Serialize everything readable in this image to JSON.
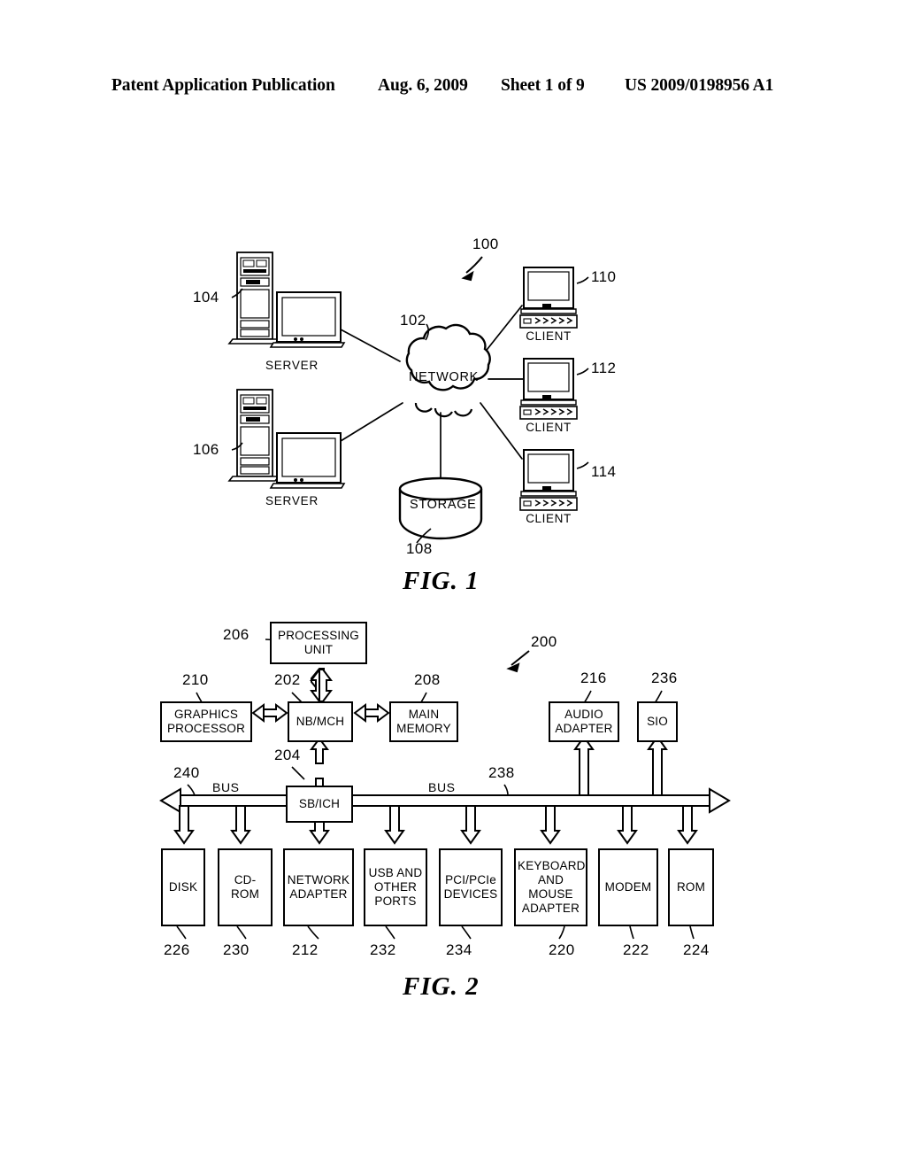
{
  "header": {
    "publication": "Patent Application Publication",
    "date": "Aug. 6, 2009",
    "sheet": "Sheet 1 of 9",
    "patent_number": "US 2009/0198956 A1"
  },
  "figures": [
    {
      "caption": "FIG. 1"
    },
    {
      "caption": "FIG. 2"
    }
  ],
  "fig1": {
    "caption": "FIG. 1",
    "system_ref": "100",
    "network": {
      "label": "NETWORK",
      "ref": "102"
    },
    "storage": {
      "label": "STORAGE",
      "ref": "108"
    },
    "servers": [
      {
        "label": "SERVER",
        "ref": "104"
      },
      {
        "label": "SERVER",
        "ref": "106"
      }
    ],
    "clients": [
      {
        "label": "CLIENT",
        "ref": "110"
      },
      {
        "label": "CLIENT",
        "ref": "112"
      },
      {
        "label": "CLIENT",
        "ref": "114"
      }
    ]
  },
  "fig2": {
    "caption": "FIG. 2",
    "system_ref": "200",
    "processing_unit": {
      "label": "PROCESSING UNIT",
      "line1": "PROCESSING",
      "line2": "UNIT",
      "ref": "206"
    },
    "graphics_processor": {
      "line1": "GRAPHICS",
      "line2": "PROCESSOR",
      "ref": "210"
    },
    "nb_mch": {
      "label": "NB/MCH",
      "ref": "202"
    },
    "main_memory": {
      "line1": "MAIN",
      "line2": "MEMORY",
      "ref": "208"
    },
    "audio_adapter": {
      "line1": "AUDIO",
      "line2": "ADAPTER",
      "ref": "216"
    },
    "sio": {
      "label": "SIO",
      "ref": "236"
    },
    "sb_ich": {
      "label": "SB/ICH",
      "ref": "204"
    },
    "bus_left": {
      "label": "BUS",
      "ref": "240"
    },
    "bus_right": {
      "label": "BUS",
      "ref": "238"
    },
    "peripherals": [
      {
        "lines": [
          "DISK"
        ],
        "ref": "226"
      },
      {
        "lines": [
          "CD-ROM"
        ],
        "ref": "230"
      },
      {
        "lines": [
          "NETWORK",
          "ADAPTER"
        ],
        "ref": "212"
      },
      {
        "lines": [
          "USB AND",
          "OTHER",
          "PORTS"
        ],
        "ref": "232"
      },
      {
        "lines": [
          "PCI/PCIe",
          "DEVICES"
        ],
        "ref": "234"
      },
      {
        "lines": [
          "KEYBOARD",
          "AND",
          "MOUSE",
          "ADAPTER"
        ],
        "ref": "220"
      },
      {
        "lines": [
          "MODEM"
        ],
        "ref": "222"
      },
      {
        "lines": [
          "ROM"
        ],
        "ref": "224"
      }
    ]
  },
  "colors": {
    "ink": "#000000",
    "paper": "#ffffff"
  }
}
